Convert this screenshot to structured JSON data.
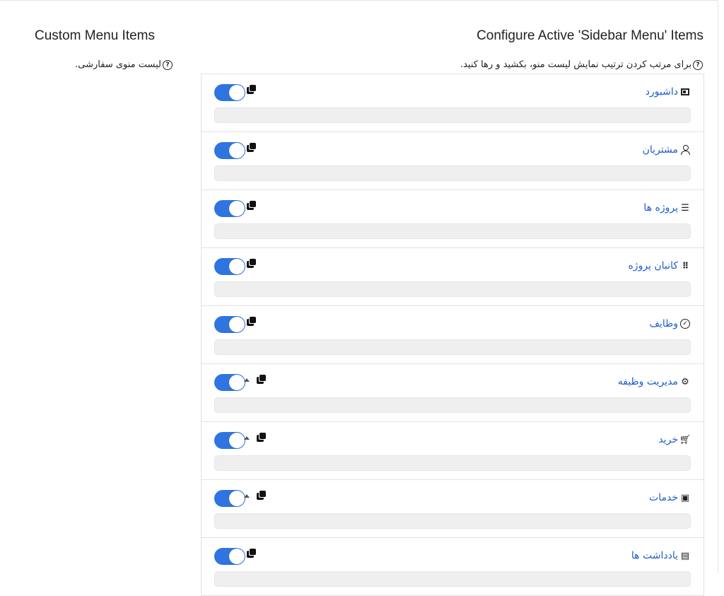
{
  "left": {
    "title": "Custom Menu Items",
    "help": "لیست منوی سفارشی."
  },
  "right": {
    "title": "Configure Active 'Sidebar Menu' Items",
    "help": "برای مرتب کردن ترتیب نمایش لیست منو، بکشید و رها کنید."
  },
  "colors": {
    "accent": "#2f74e0",
    "link": "#1d5ec9"
  },
  "menu_items": [
    {
      "label": "داشبورد",
      "icon": "dashboard-icon",
      "enabled": true,
      "has_children": false
    },
    {
      "label": "مشتریان",
      "icon": "user-icon",
      "enabled": true,
      "has_children": false
    },
    {
      "label": "پروژه ها",
      "icon": "projects-icon",
      "enabled": true,
      "has_children": false
    },
    {
      "label": "کانبان پروژه",
      "icon": "kanban-icon",
      "enabled": true,
      "has_children": false
    },
    {
      "label": "وظایف",
      "icon": "check-circle-icon",
      "enabled": true,
      "has_children": false
    },
    {
      "label": "مدیریت وظیفه",
      "icon": "gears-icon",
      "enabled": true,
      "has_children": true
    },
    {
      "label": "خرید",
      "icon": "cart-icon",
      "enabled": true,
      "has_children": true
    },
    {
      "label": "خدمات",
      "icon": "services-icon",
      "enabled": true,
      "has_children": true
    },
    {
      "label": "یادداشت ها",
      "icon": "note-icon",
      "enabled": true,
      "has_children": false
    }
  ]
}
